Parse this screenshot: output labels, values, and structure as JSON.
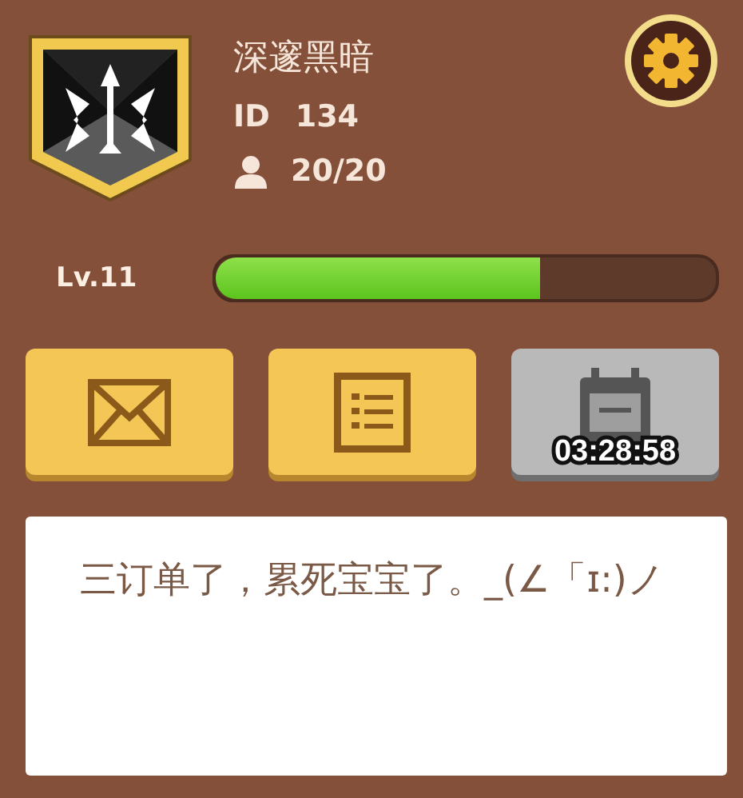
{
  "profile": {
    "name": "深邃黑暗",
    "id_label": "ID",
    "id_value": "134",
    "members": "20/20"
  },
  "level": {
    "label": "Lv.11",
    "level": 0.65
  },
  "buttons": [
    {
      "kind": "mail",
      "disabled": false
    },
    {
      "kind": "list",
      "disabled": false
    },
    {
      "kind": "calendar",
      "disabled": true,
      "timer": "03:28:58"
    }
  ],
  "message": "三订单了，累死宝宝了。_(∠「ɪ:)ノ"
}
